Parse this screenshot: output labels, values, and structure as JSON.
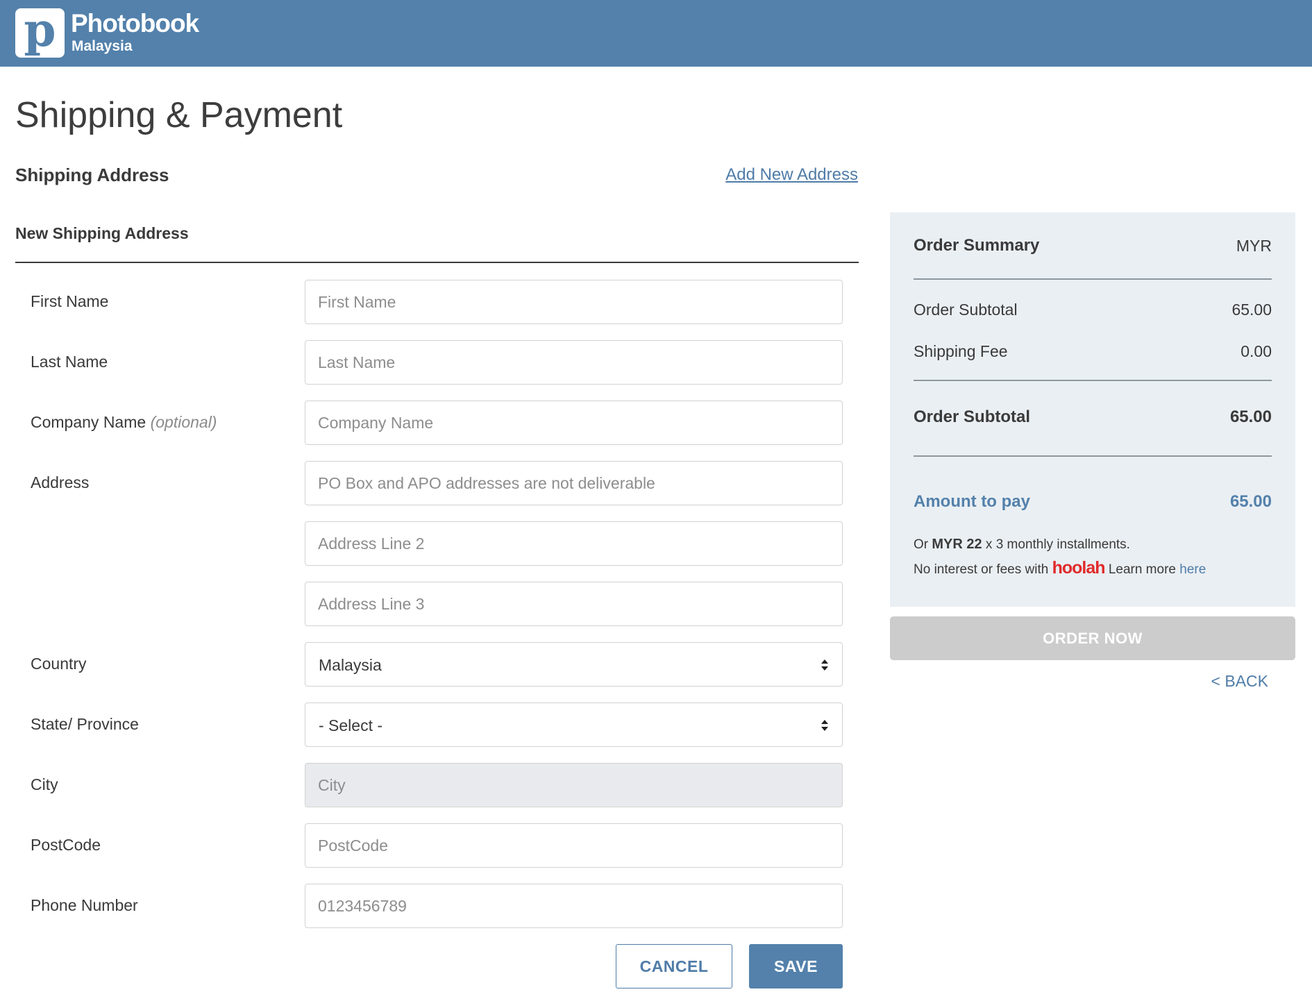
{
  "brand": {
    "logo_letter": "p",
    "name": "Photobook",
    "sub": "Malaysia",
    "header_color": "#5381ab"
  },
  "page": {
    "title": "Shipping & Payment"
  },
  "shipping": {
    "section_title": "Shipping Address",
    "add_link": "Add New Address",
    "sub_title": "New Shipping Address"
  },
  "form": {
    "first_name": {
      "label": "First Name",
      "placeholder": "First Name"
    },
    "last_name": {
      "label": "Last Name",
      "placeholder": "Last Name"
    },
    "company": {
      "label": "Company Name",
      "optional": "(optional)",
      "placeholder": "Company Name"
    },
    "address": {
      "label": "Address",
      "placeholder1": "PO Box and APO addresses are not deliverable",
      "placeholder2": "Address Line 2",
      "placeholder3": "Address Line 3"
    },
    "country": {
      "label": "Country",
      "value": "Malaysia"
    },
    "state": {
      "label": "State/ Province",
      "value": "- Select -"
    },
    "city": {
      "label": "City",
      "placeholder": "City"
    },
    "postcode": {
      "label": "PostCode",
      "placeholder": "PostCode"
    },
    "phone": {
      "label": "Phone Number",
      "placeholder": "0123456789"
    },
    "cancel_label": "CANCEL",
    "save_label": "SAVE"
  },
  "summary": {
    "title": "Order Summary",
    "currency": "MYR",
    "subtotal_label": "Order Subtotal",
    "subtotal_value": "65.00",
    "shipping_label": "Shipping Fee",
    "shipping_value": "0.00",
    "total_label": "Order Subtotal",
    "total_value": "65.00",
    "pay_label": "Amount to pay",
    "pay_value": "65.00",
    "inst_or": "Or",
    "inst_amount": "MYR 22",
    "inst_rest": "x 3 monthly installments.",
    "inst_line2_pre": "No interest or fees with",
    "inst_brand": "hoolah",
    "inst_learn": "Learn more",
    "inst_here": "here"
  },
  "actions": {
    "order_now": "ORDER NOW",
    "back": "< BACK"
  }
}
